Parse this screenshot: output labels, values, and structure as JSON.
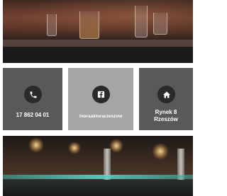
{
  "contact": {
    "phone": {
      "icon": "phone-icon",
      "label": "17 862 04 01"
    },
    "facebook": {
      "icon": "facebook-icon",
      "label": "/noraaktorarzeszow"
    },
    "address": {
      "icon": "home-icon",
      "line1": "Rynek 8",
      "line2": "Rzeszów"
    }
  },
  "colors": {
    "tile_dark": "#595959",
    "tile_light": "#a5a5a5",
    "icon_circle": "#2a2a2a",
    "text": "#ffffff"
  }
}
